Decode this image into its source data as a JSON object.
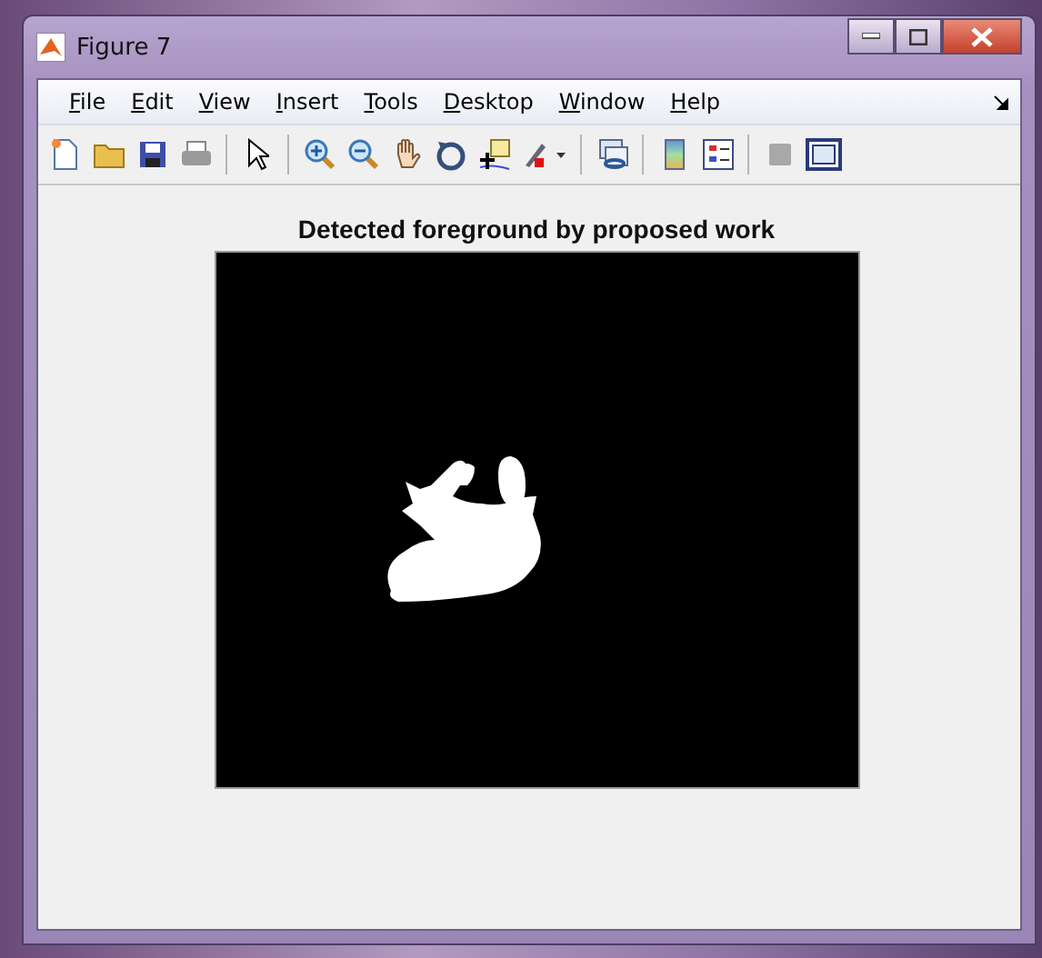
{
  "window": {
    "title": "Figure 7"
  },
  "menu": [
    "File",
    "Edit",
    "View",
    "Insert",
    "Tools",
    "Desktop",
    "Window",
    "Help"
  ],
  "toolbar": [
    {
      "kind": "new"
    },
    {
      "kind": "open"
    },
    {
      "kind": "save"
    },
    {
      "kind": "print"
    },
    {
      "kind": "separator"
    },
    {
      "kind": "pointer"
    },
    {
      "kind": "separator"
    },
    {
      "kind": "zoom-in"
    },
    {
      "kind": "zoom-out"
    },
    {
      "kind": "pan"
    },
    {
      "kind": "rotate"
    },
    {
      "kind": "cursor"
    },
    {
      "kind": "brush"
    },
    {
      "kind": "separator"
    },
    {
      "kind": "link"
    },
    {
      "kind": "separator"
    },
    {
      "kind": "colorbar"
    },
    {
      "kind": "legend"
    },
    {
      "kind": "separator"
    },
    {
      "kind": "hide"
    },
    {
      "kind": "tools"
    }
  ],
  "axes": {
    "title": "Detected foreground by proposed work",
    "kind": "picture"
  }
}
